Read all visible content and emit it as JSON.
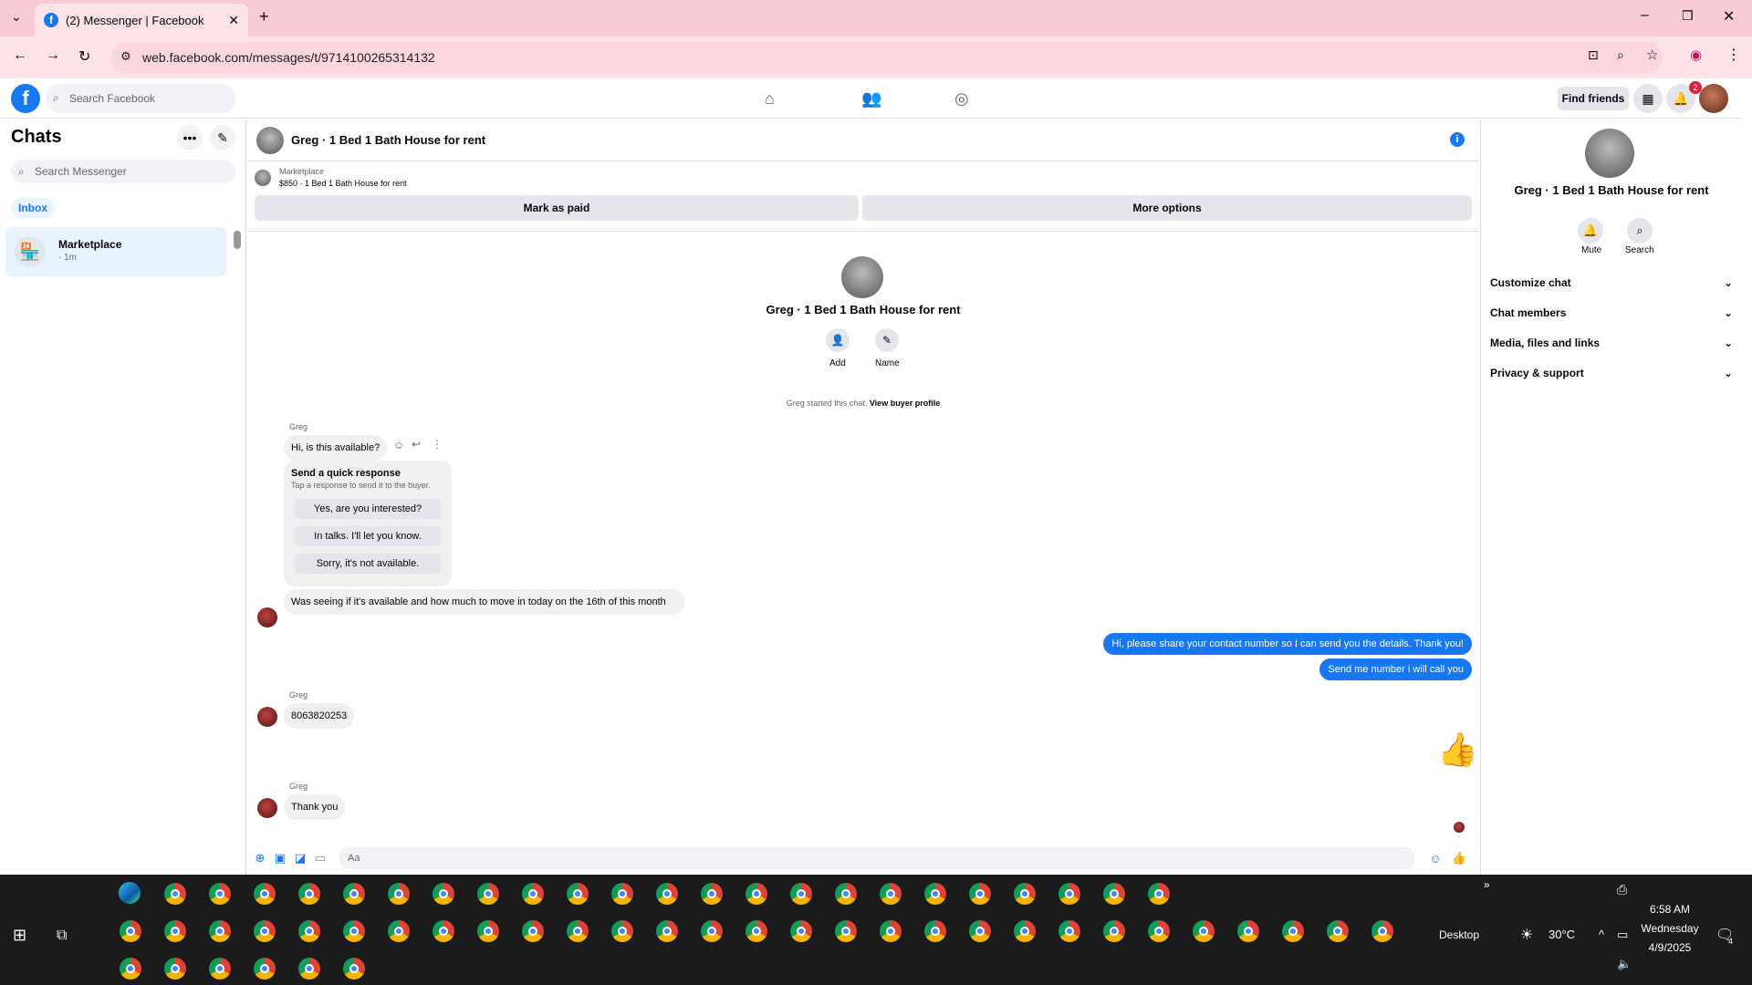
{
  "browser": {
    "tab_title": "(2) Messenger | Facebook",
    "url": "web.facebook.com/messages/t/9714100265314132"
  },
  "fb_header": {
    "logo": "f",
    "search_placeholder": "Search Facebook",
    "find_friends": "Find friends",
    "notification_count": "2"
  },
  "left": {
    "title": "Chats",
    "search_placeholder": "Search Messenger",
    "inbox": "Inbox",
    "conversation": {
      "name": "Marketplace",
      "time": "· 1m"
    }
  },
  "main": {
    "title": "Greg · 1 Bed 1 Bath House for rent",
    "marketplace_label": "Marketplace",
    "listing": "$850 · 1 Bed 1 Bath House for rent",
    "mark_paid": "Mark as paid",
    "more_options": "More options",
    "center_name": "Greg · 1 Bed 1 Bath House for rent",
    "add_label": "Add",
    "name_label": "Name",
    "started_text": "Greg started this chat.",
    "view_profile": "View buyer profile",
    "sender": "Greg",
    "msg1": "Hi, is this available?",
    "quick_title": "Send a quick response",
    "quick_sub": "Tap a response to send it to the buyer.",
    "quick_replies": [
      "Yes, are you interested?",
      "In talks. I'll let you know.",
      "Sorry, it's not available."
    ],
    "msg2": "Was seeing if it's available and how much to move in today on the 16th of this month",
    "out1": "Hi, please share your contact number so I can send you the details. Thank you!",
    "out2": "Send me number i will call you",
    "msg3": "8063820253",
    "msg4": "Thank you",
    "composer_placeholder": "Aa"
  },
  "right": {
    "name": "Greg · 1 Bed 1 Bath House for rent",
    "mute": "Mute",
    "search": "Search",
    "rows": [
      "Customize chat",
      "Chat members",
      "Media, files and links",
      "Privacy & support"
    ]
  },
  "taskbar": {
    "desktop": "Desktop",
    "temperature": "30°C",
    "time": "6:58 AM",
    "day": "Wednesday",
    "date": "4/9/2025",
    "notif_count": "4"
  },
  "colors": {
    "fb_blue": "#1877f2",
    "tabbar_bg": "#f9cbd5"
  }
}
